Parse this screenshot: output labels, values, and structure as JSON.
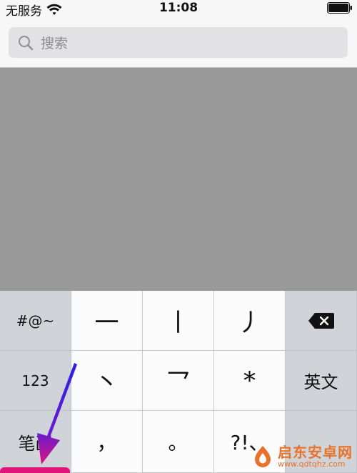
{
  "status_bar": {
    "carrier": "无服务",
    "time": "11:08",
    "wifi_icon": "wifi-icon",
    "battery_icon": "battery-full-icon"
  },
  "search": {
    "placeholder": "搜索",
    "icon": "search-icon"
  },
  "keyboard": {
    "symbols_key": "#@~",
    "numbers_key": "123",
    "handwriting_key": "笔画",
    "english_key": "英文",
    "delete_icon": "delete-backspace-icon",
    "row1": [
      "一",
      "丨",
      "丿"
    ],
    "row2": [
      "丶",
      "乛",
      "*"
    ],
    "row3": [
      "，",
      "。",
      "?!、"
    ]
  },
  "watermark": {
    "title": "启东安卓网",
    "url": "www.qdtqhz.com"
  },
  "colors": {
    "dim_overlay": "#999999",
    "arrow_blue": "#2a1fe0",
    "arrow_pink": "#e0147a",
    "watermark_orange": "#e8722c"
  }
}
